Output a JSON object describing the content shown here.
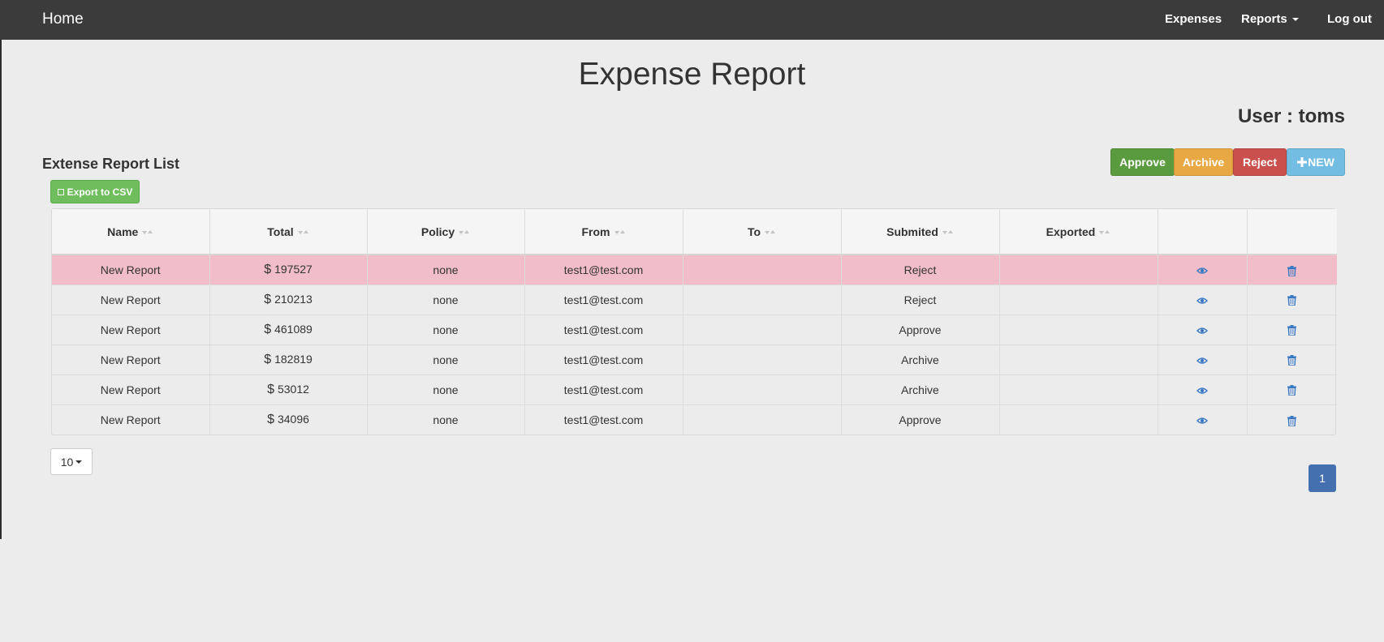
{
  "navbar": {
    "brand": "Home",
    "links": {
      "expenses": "Expenses",
      "reports": "Reports",
      "logout": "Log out"
    }
  },
  "page": {
    "title": "Expense Report",
    "user_label": "User : toms",
    "list_title": "Extense Report List"
  },
  "actions": {
    "approve": "Approve",
    "archive": "Archive",
    "reject": "Reject",
    "new": "NEW",
    "export_csv": "Export to CSV"
  },
  "table": {
    "headers": [
      "Name",
      "Total",
      "Policy",
      "From",
      "To",
      "Submited",
      "Exported",
      "",
      ""
    ],
    "currency_symbol": "$",
    "rows": [
      {
        "name": "New Report",
        "total": "197527",
        "policy": "none",
        "from": "test1@test.com",
        "to": "",
        "submitted": "Reject",
        "exported": "",
        "selected": true
      },
      {
        "name": "New Report",
        "total": "210213",
        "policy": "none",
        "from": "test1@test.com",
        "to": "",
        "submitted": "Reject",
        "exported": "",
        "selected": false
      },
      {
        "name": "New Report",
        "total": "461089",
        "policy": "none",
        "from": "test1@test.com",
        "to": "",
        "submitted": "Approve",
        "exported": "",
        "selected": false
      },
      {
        "name": "New Report",
        "total": "182819",
        "policy": "none",
        "from": "test1@test.com",
        "to": "",
        "submitted": "Archive",
        "exported": "",
        "selected": false
      },
      {
        "name": "New Report",
        "total": "53012",
        "policy": "none",
        "from": "test1@test.com",
        "to": "",
        "submitted": "Archive",
        "exported": "",
        "selected": false
      },
      {
        "name": "New Report",
        "total": "34096",
        "policy": "none",
        "from": "test1@test.com",
        "to": "",
        "submitted": "Approve",
        "exported": "",
        "selected": false
      }
    ],
    "row_icons": {
      "view": "eye-icon",
      "delete": "trash-icon"
    }
  },
  "pagination": {
    "page_size": "10",
    "current_page": "1"
  },
  "colors": {
    "navbar": "#3b3b3b",
    "approve": "#5b9b3f",
    "archive": "#e8a944",
    "reject": "#c9504c",
    "new": "#74bde2",
    "export": "#6fbd5c",
    "selected_row": "#f0bdc8",
    "icon": "#3b78c4",
    "active_page": "#4470b0"
  }
}
